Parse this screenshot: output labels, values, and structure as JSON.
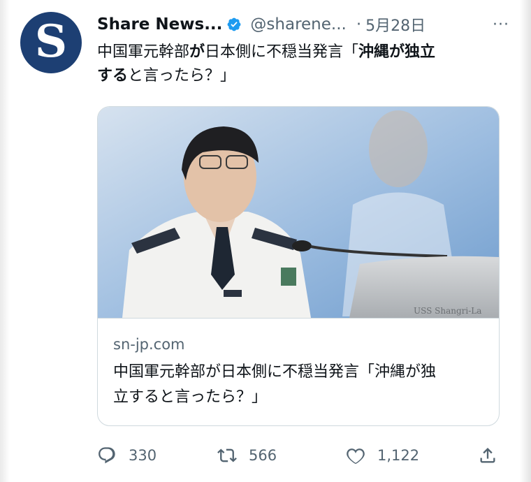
{
  "tweet": {
    "author_initial": "S",
    "author_name": "Share News...",
    "handle": "@sharene...",
    "separator": "·",
    "date": "5月28日",
    "more": "···",
    "text_line1_a": "中国軍元幹部",
    "text_line1_b": "が",
    "text_line1_c": "日本側に不穏当発言「",
    "text_line1_d": "沖縄が独立",
    "text_line2_a": "する",
    "text_line2_b": "と言ったら？」"
  },
  "card": {
    "domain": "sn-jp.com",
    "title_line1": "中国軍元幹部が日本側に不穏当発言「沖縄が独",
    "title_line2": "立すると言ったら？」",
    "image_caption_text": "USS Shangri-La"
  },
  "actions": {
    "replies": "330",
    "retweets": "566",
    "likes": "1,122"
  },
  "colors": {
    "avatar_bg": "#1d3f73",
    "verified": "#1d9bf0",
    "secondary_text": "#536471",
    "border": "#cfd9de"
  }
}
